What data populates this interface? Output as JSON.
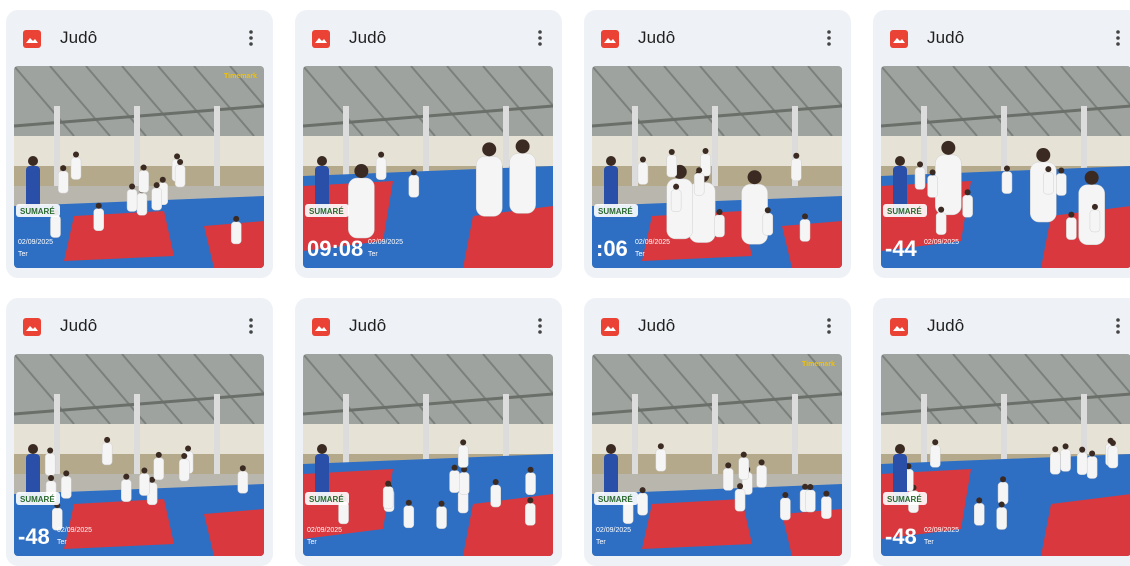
{
  "files": [
    {
      "title": "Judô",
      "file_type_icon": "image-file-icon",
      "stamp_time": "",
      "stamp_date": "02/09/2025",
      "stamp_day": "Ter",
      "logo_text": "SUMARÉ",
      "watermark": "Timemark",
      "variant": 0
    },
    {
      "title": "Judô",
      "file_type_icon": "image-file-icon",
      "stamp_time": "09:08",
      "stamp_date": "02/09/2025",
      "stamp_day": "Ter",
      "logo_text": "SUMARÉ",
      "watermark": "",
      "variant": 1
    },
    {
      "title": "Judô",
      "file_type_icon": "image-file-icon",
      "stamp_time": ":06",
      "stamp_date": "02/09/2025",
      "stamp_day": "Ter",
      "logo_text": "SUMARÉ",
      "watermark": "",
      "variant": 2
    },
    {
      "title": "Judô",
      "file_type_icon": "image-file-icon",
      "stamp_time": "-44",
      "stamp_date": "02/09/2025",
      "stamp_day": "",
      "logo_text": "SUMARÉ",
      "watermark": "",
      "variant": 3
    },
    {
      "title": "Judô",
      "file_type_icon": "image-file-icon",
      "stamp_time": "-48",
      "stamp_date": "02/09/2025",
      "stamp_day": "Ter",
      "logo_text": "SUMARÉ",
      "watermark": "",
      "variant": 4
    },
    {
      "title": "Judô",
      "file_type_icon": "image-file-icon",
      "stamp_time": "",
      "stamp_date": "02/09/2025",
      "stamp_day": "Ter",
      "logo_text": "SUMARÉ",
      "watermark": "",
      "variant": 5
    },
    {
      "title": "Judô",
      "file_type_icon": "image-file-icon",
      "stamp_time": "",
      "stamp_date": "02/09/2025",
      "stamp_day": "Ter",
      "logo_text": "SUMARÉ",
      "watermark": "Timemark",
      "variant": 6
    },
    {
      "title": "Judô",
      "file_type_icon": "image-file-icon",
      "stamp_time": "-48",
      "stamp_date": "02/09/2025",
      "stamp_day": "Ter",
      "logo_text": "SUMARÉ",
      "watermark": "",
      "variant": 7
    }
  ],
  "menu_icon": "more-vert-icon",
  "colors": {
    "card_bg": "#eef1f6",
    "file_icon": "#ea4335",
    "mat_blue": "#2e6fc4",
    "mat_red": "#d8383e"
  }
}
